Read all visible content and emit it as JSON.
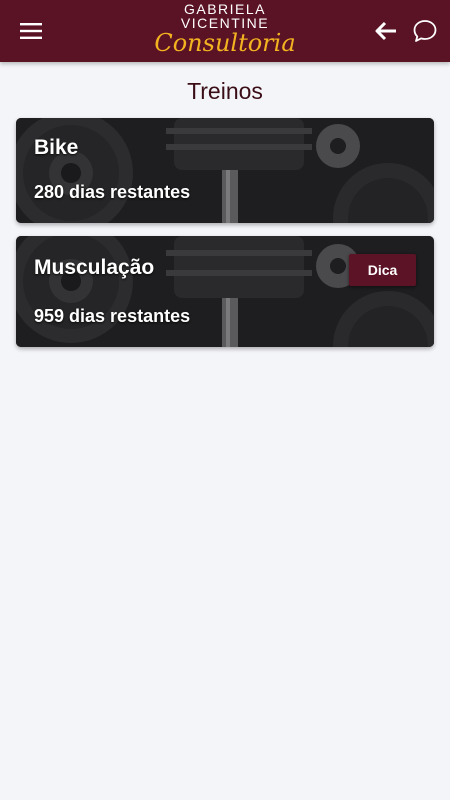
{
  "header": {
    "logo_line1": "GABRIELA",
    "logo_line2": "VICENTINE",
    "logo_script": "Consultoria",
    "menu_icon": "menu-icon",
    "back_icon": "arrow-left-icon",
    "chat_icon": "chat-bubble-icon"
  },
  "page": {
    "title": "Treinos"
  },
  "workouts": [
    {
      "name": "Bike",
      "remaining": "280 dias restantes"
    },
    {
      "name": "Musculação",
      "remaining": "959 dias restantes",
      "tip_label": "Dica"
    }
  ],
  "colors": {
    "appbar": "#5a1325",
    "logo_script": "#f3b320",
    "tip_button": "#5c1326",
    "background": "#f4f5f9"
  }
}
